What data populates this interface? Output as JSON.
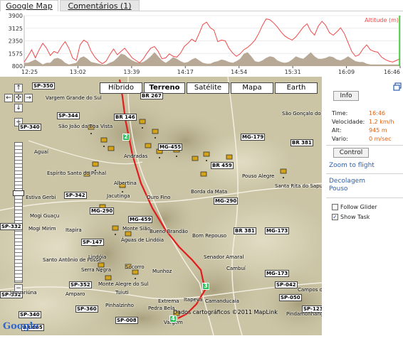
{
  "tabs": {
    "active": "Google Map",
    "inactive": "Comentários (1)"
  },
  "altitude_chart": {
    "legend": "Altitude (m)",
    "y_ticks": [
      "3900",
      "3125",
      "2350",
      "1575",
      "800"
    ],
    "x_ticks": [
      "12:25",
      "13:02",
      "13:39",
      "14:17",
      "14:54",
      "15:31",
      "16:09",
      "16:46"
    ],
    "ylim": [
      800,
      3900
    ],
    "altitude_series": [
      1050,
      1400,
      1800,
      1300,
      1800,
      2200,
      1900,
      1450,
      1700,
      1600,
      2000,
      2300,
      1900,
      1300,
      1150,
      2100,
      2400,
      2250,
      1700,
      1350,
      1100,
      950,
      1100,
      1500,
      1850,
      1500,
      1700,
      1900,
      1600,
      1300,
      1150,
      1000,
      1250,
      1600,
      1900,
      2000,
      1700,
      1250,
      1300,
      1550,
      1400,
      1350,
      1600,
      2000,
      2200,
      2450,
      2300,
      2800,
      3350,
      3500,
      3150,
      3000,
      2300,
      2400,
      2350,
      1900,
      1600,
      1400,
      1550,
      1800,
      1950,
      2150,
      2400,
      2800,
      3300,
      3700,
      3650,
      3450,
      3200,
      2900,
      2650,
      2500,
      2400,
      2600,
      2900,
      3200,
      3400,
      2950,
      2700,
      3250,
      3550,
      3300,
      2850,
      2700,
      2900,
      3150,
      2800,
      2250,
      1700,
      1400,
      1500,
      1850,
      2100,
      1800,
      1700,
      1650,
      1350,
      1200,
      1100,
      1050,
      1150,
      1250
    ],
    "terrain_series": [
      1000,
      1000,
      1100,
      1200,
      1050,
      900,
      1000,
      1000,
      1250,
      1300,
      1200,
      1000,
      900,
      950,
      1000,
      1300,
      1400,
      1250,
      1050,
      1000,
      950,
      900,
      900,
      1000,
      1100,
      1300,
      1550,
      1500,
      1300,
      1150,
      1050,
      1000,
      1050,
      1200,
      1400,
      1650,
      1400,
      1150,
      1000,
      1150,
      1350,
      1250,
      1100,
      1000,
      1050,
      1200,
      1300,
      1150,
      1000,
      950,
      950,
      1050,
      1100,
      1200,
      1150,
      1050,
      1000,
      1100,
      1250,
      1550,
      1650,
      1400,
      1100,
      1050,
      1150,
      1300,
      1400,
      1350,
      1150,
      1050,
      1000,
      1050,
      1200,
      1400,
      1300,
      1250,
      1450,
      1650,
      1400,
      1250,
      1250,
      1300,
      1400,
      1350,
      1200,
      1150,
      1250,
      1400,
      1250,
      1100,
      1050,
      1050,
      950,
      900,
      900,
      900,
      900,
      900,
      900,
      900,
      900,
      900
    ],
    "altitude_color": "#ef4a4a",
    "terrain_color": "#b8a896",
    "marker_color": "#2fd12f"
  },
  "map": {
    "buttons": [
      "Híbrido",
      "Terreno",
      "Satélite",
      "Mapa",
      "Earth"
    ],
    "selected_button": "Terreno",
    "roads": [
      "SP-350",
      "SP-344",
      "BR 146",
      "BR 267",
      "MG-455",
      "SP-340",
      "MG-179",
      "BR 459",
      "BR 381",
      "SP-342",
      "MG-290",
      "MG-290",
      "MG-459",
      "SP-147",
      "BR 381",
      "MG-173",
      "MG-173",
      "SP-352",
      "SP-042",
      "SP-360",
      "SP-008",
      "SP-050",
      "SP-123",
      "SP-340",
      "BR 065",
      "SP-332",
      "MG-459",
      "SP-332"
    ],
    "towns": [
      "Vargem Grande do Sul",
      "São João da Boa Vista",
      "Aguaí",
      "Andradas",
      "Espírito Santo do Pinhal",
      "Estiva Gerbi",
      "Albertina",
      "Jacutinga",
      "Ouro Fino",
      "Borda da Mata",
      "Pouso Alegre",
      "Santa Rita do Sapucaí",
      "São Gonçalo do Sapucaí",
      "Mogi Guaçu",
      "Mogi Mirim",
      "Itapira",
      "Monte Sião",
      "Águas de Lindóia",
      "Bueno Brandão",
      "Bom Repouso",
      "Senador Amaral",
      "Santo Antônio de Posse",
      "Lindóia",
      "Serra Negra",
      "Socorro",
      "Munhoz",
      "Cambuí",
      "Jaguariúna",
      "Amparo",
      "Monte Alegre do Sul",
      "Pinhalzinho",
      "Pedra Bela",
      "Camanducaia",
      "Itapeva",
      "Extrema",
      "Vargem",
      "Campos do Jordão",
      "Pindamonhangaba",
      "Tuiuti"
    ],
    "waypoints": [
      "2",
      "3",
      "4"
    ],
    "copyright": "Dados cartográficos ©2011 MapLink",
    "google_logo": "Google"
  },
  "side_panel": {
    "info_button": "Info",
    "time_label": "Time:",
    "time_value": "16:46",
    "speed_label": "Velocidade:",
    "speed_value": "1.2 km/h",
    "alt_label": "Alt:",
    "alt_value": "945 m",
    "vario_label": "Vario:",
    "vario_value": "0 m/sec",
    "control_button": "Control",
    "zoom_link": "Zoom to flight",
    "takeoff_link": "Decolagem Pouso",
    "follow_glider": "Follow Glider",
    "follow_glider_checked": false,
    "show_task": "Show Task",
    "show_task_checked": true
  }
}
